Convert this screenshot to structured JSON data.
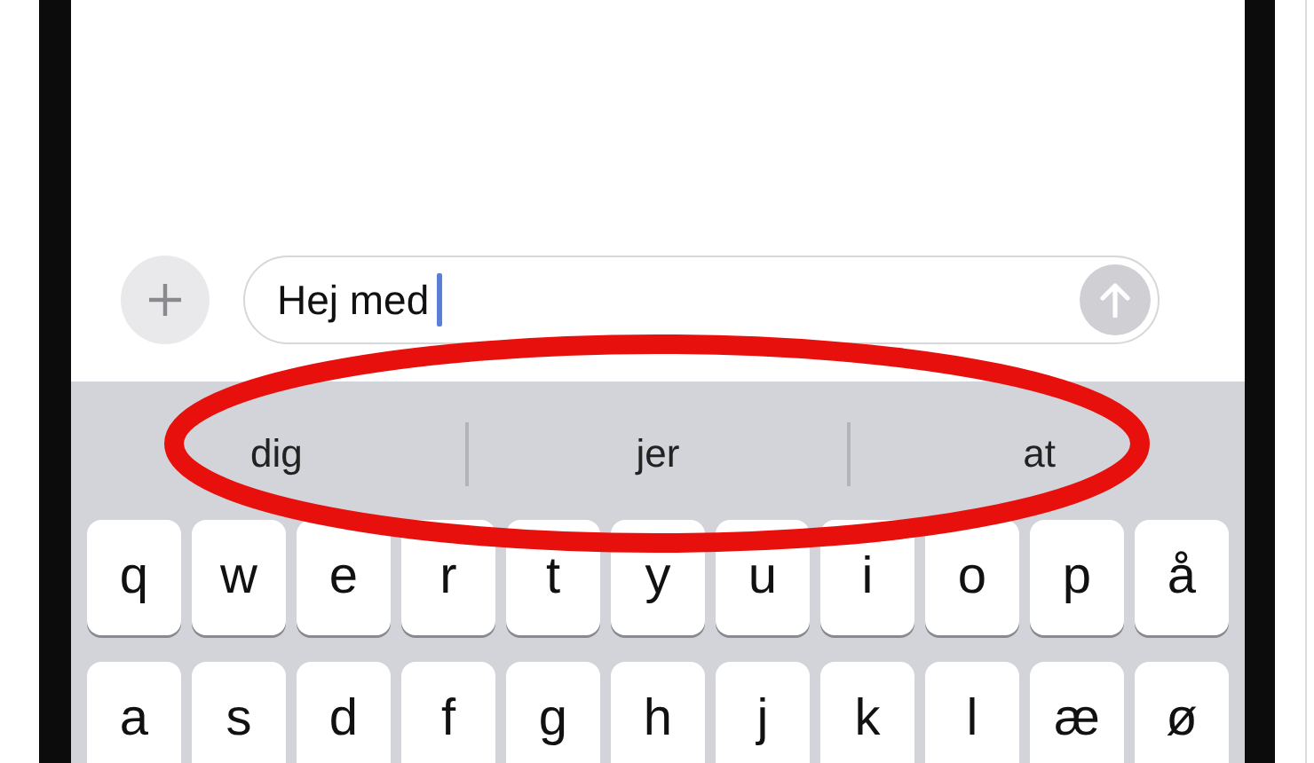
{
  "composer": {
    "value": "Hej med"
  },
  "suggestions": [
    {
      "text": "dig"
    },
    {
      "text": "jer"
    },
    {
      "text": "at"
    }
  ],
  "keyboard": {
    "rows": [
      [
        "q",
        "w",
        "e",
        "r",
        "t",
        "y",
        "u",
        "i",
        "o",
        "p",
        "å"
      ],
      [
        "a",
        "s",
        "d",
        "f",
        "g",
        "h",
        "j",
        "k",
        "l",
        "æ",
        "ø"
      ]
    ]
  }
}
